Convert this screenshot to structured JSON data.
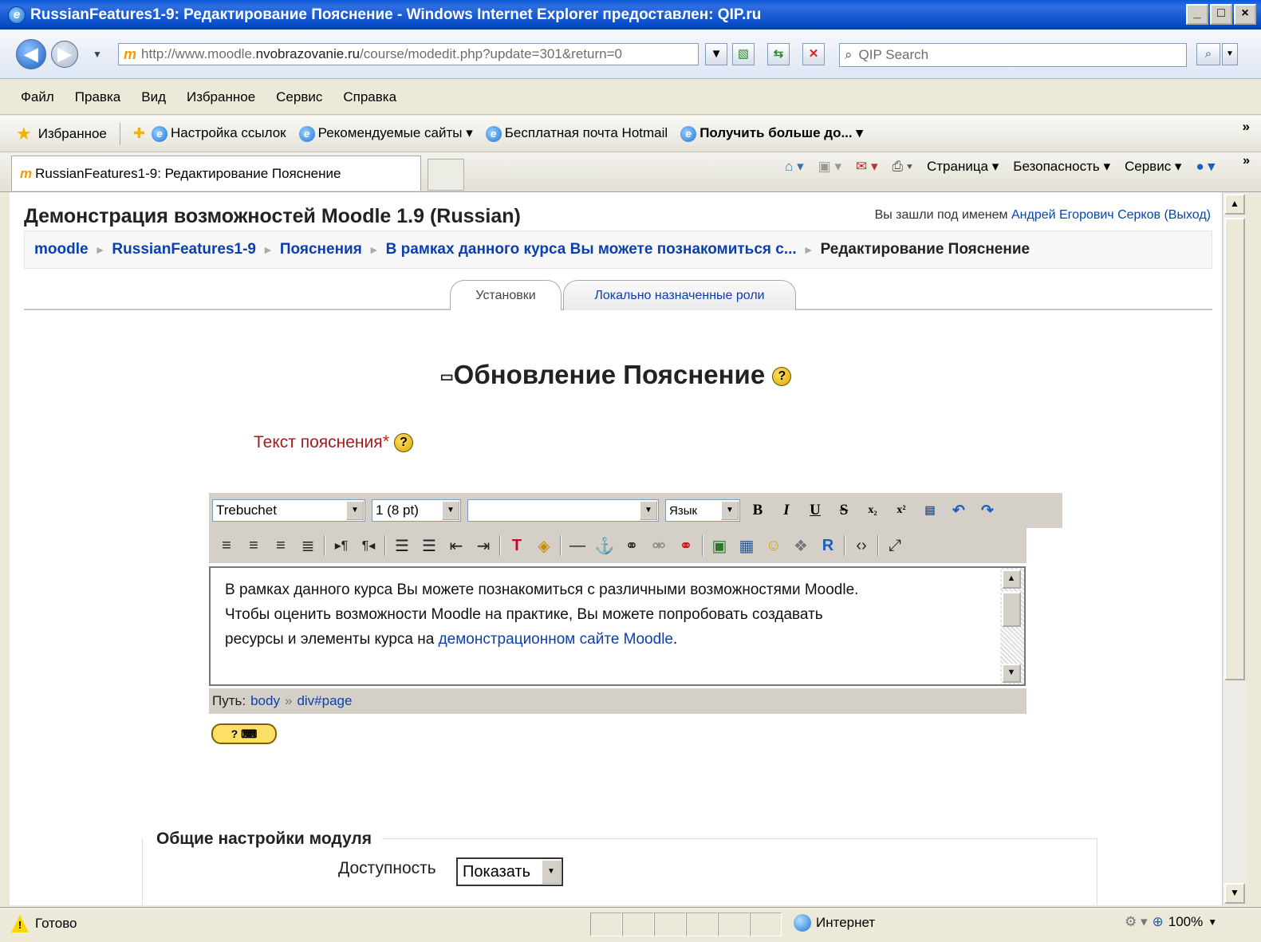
{
  "window": {
    "title": "RussianFeatures1-9: Редактирование Пояснение - Windows Internet Explorer предоставлен: QIP.ru"
  },
  "address": {
    "url_pre": "http://www.moodle.",
    "url_bold": "nvobrazovanie.ru",
    "url_post": "/course/modedit.php?update=301&return=0",
    "search_placeholder": "QIP Search"
  },
  "menu": [
    "Файл",
    "Правка",
    "Вид",
    "Избранное",
    "Сервис",
    "Справка"
  ],
  "favorites": {
    "label": "Избранное",
    "items": [
      "Настройка ссылок",
      "Рекомендуемые сайты ▾",
      "Бесплатная почта Hotmail",
      "Получить больше до... ▾"
    ]
  },
  "tab": {
    "label": "RussianFeatures1-9: Редактирование Пояснение"
  },
  "commandbar": [
    "Страница ▾",
    "Безопасность ▾",
    "Сервис ▾"
  ],
  "page": {
    "site_title": "Демонстрация возможностей Moodle 1.9 (Russian)",
    "login_prefix": "Вы зашли под именем",
    "login_user": "Андрей Егорович Серков",
    "logout": "(Выход)",
    "breadcrumb": [
      "moodle",
      "RussianFeatures1-9",
      "Пояснения",
      "В рамках данного курса Вы можете познакомиться с...",
      "Редактирование Пояснение"
    ],
    "tabs": [
      "Установки",
      "Локально назначенные роли"
    ],
    "form_title": "Обновление Пояснение",
    "field_label": "Текст пояснения",
    "required_mark": "*"
  },
  "editor": {
    "font": "Trebuchet",
    "size": "1 (8 pt)",
    "style": "",
    "lang": "Язык",
    "text_line1": "В рамках данного курса Вы можете познакомиться с различными возможностями Moodle.",
    "text_line2": "Чтобы оценить возможности Moodle на практике, Вы можете попробовать создавать",
    "text_line3_pre": "ресурсы и элементы курса на ",
    "text_link": "демонстрационном сайте Moodle",
    "text_line3_post": ".",
    "path_label": "Путь:",
    "path_body": "body",
    "path_sep": "»",
    "path_div": "div#page"
  },
  "module_settings": {
    "legend": "Общие настройки модуля",
    "availability_label": "Доступность",
    "availability_value": "Показать"
  },
  "statusbar": {
    "status": "Готово",
    "zone": "Интернет",
    "zoom": "100%"
  }
}
